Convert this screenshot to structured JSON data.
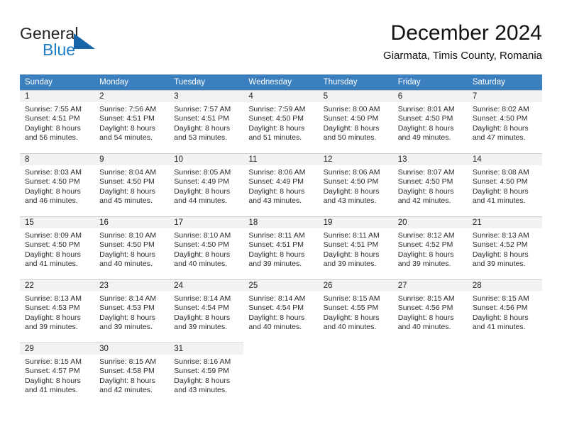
{
  "brand": {
    "name_part1": "General",
    "name_part2": "Blue",
    "logo_icon": "triangle-logo-icon"
  },
  "header": {
    "title": "December 2024",
    "subtitle": "Giarmata, Timis County, Romania"
  },
  "colors": {
    "header_row": "#3b7fbe",
    "brand_blue": "#1b7ec4",
    "logo_dark_blue": "#1565a8",
    "cell_head_bg": "#f2f2f2",
    "grid_line": "#cfcfcf"
  },
  "calendar": {
    "weekday_headers": [
      "Sunday",
      "Monday",
      "Tuesday",
      "Wednesday",
      "Thursday",
      "Friday",
      "Saturday"
    ],
    "weeks": [
      [
        {
          "day": "1",
          "sunrise": "Sunrise: 7:55 AM",
          "sunset": "Sunset: 4:51 PM",
          "daylight_line1": "Daylight: 8 hours",
          "daylight_line2": "and 56 minutes."
        },
        {
          "day": "2",
          "sunrise": "Sunrise: 7:56 AM",
          "sunset": "Sunset: 4:51 PM",
          "daylight_line1": "Daylight: 8 hours",
          "daylight_line2": "and 54 minutes."
        },
        {
          "day": "3",
          "sunrise": "Sunrise: 7:57 AM",
          "sunset": "Sunset: 4:51 PM",
          "daylight_line1": "Daylight: 8 hours",
          "daylight_line2": "and 53 minutes."
        },
        {
          "day": "4",
          "sunrise": "Sunrise: 7:59 AM",
          "sunset": "Sunset: 4:50 PM",
          "daylight_line1": "Daylight: 8 hours",
          "daylight_line2": "and 51 minutes."
        },
        {
          "day": "5",
          "sunrise": "Sunrise: 8:00 AM",
          "sunset": "Sunset: 4:50 PM",
          "daylight_line1": "Daylight: 8 hours",
          "daylight_line2": "and 50 minutes."
        },
        {
          "day": "6",
          "sunrise": "Sunrise: 8:01 AM",
          "sunset": "Sunset: 4:50 PM",
          "daylight_line1": "Daylight: 8 hours",
          "daylight_line2": "and 49 minutes."
        },
        {
          "day": "7",
          "sunrise": "Sunrise: 8:02 AM",
          "sunset": "Sunset: 4:50 PM",
          "daylight_line1": "Daylight: 8 hours",
          "daylight_line2": "and 47 minutes."
        }
      ],
      [
        {
          "day": "8",
          "sunrise": "Sunrise: 8:03 AM",
          "sunset": "Sunset: 4:50 PM",
          "daylight_line1": "Daylight: 8 hours",
          "daylight_line2": "and 46 minutes."
        },
        {
          "day": "9",
          "sunrise": "Sunrise: 8:04 AM",
          "sunset": "Sunset: 4:50 PM",
          "daylight_line1": "Daylight: 8 hours",
          "daylight_line2": "and 45 minutes."
        },
        {
          "day": "10",
          "sunrise": "Sunrise: 8:05 AM",
          "sunset": "Sunset: 4:49 PM",
          "daylight_line1": "Daylight: 8 hours",
          "daylight_line2": "and 44 minutes."
        },
        {
          "day": "11",
          "sunrise": "Sunrise: 8:06 AM",
          "sunset": "Sunset: 4:49 PM",
          "daylight_line1": "Daylight: 8 hours",
          "daylight_line2": "and 43 minutes."
        },
        {
          "day": "12",
          "sunrise": "Sunrise: 8:06 AM",
          "sunset": "Sunset: 4:50 PM",
          "daylight_line1": "Daylight: 8 hours",
          "daylight_line2": "and 43 minutes."
        },
        {
          "day": "13",
          "sunrise": "Sunrise: 8:07 AM",
          "sunset": "Sunset: 4:50 PM",
          "daylight_line1": "Daylight: 8 hours",
          "daylight_line2": "and 42 minutes."
        },
        {
          "day": "14",
          "sunrise": "Sunrise: 8:08 AM",
          "sunset": "Sunset: 4:50 PM",
          "daylight_line1": "Daylight: 8 hours",
          "daylight_line2": "and 41 minutes."
        }
      ],
      [
        {
          "day": "15",
          "sunrise": "Sunrise: 8:09 AM",
          "sunset": "Sunset: 4:50 PM",
          "daylight_line1": "Daylight: 8 hours",
          "daylight_line2": "and 41 minutes."
        },
        {
          "day": "16",
          "sunrise": "Sunrise: 8:10 AM",
          "sunset": "Sunset: 4:50 PM",
          "daylight_line1": "Daylight: 8 hours",
          "daylight_line2": "and 40 minutes."
        },
        {
          "day": "17",
          "sunrise": "Sunrise: 8:10 AM",
          "sunset": "Sunset: 4:50 PM",
          "daylight_line1": "Daylight: 8 hours",
          "daylight_line2": "and 40 minutes."
        },
        {
          "day": "18",
          "sunrise": "Sunrise: 8:11 AM",
          "sunset": "Sunset: 4:51 PM",
          "daylight_line1": "Daylight: 8 hours",
          "daylight_line2": "and 39 minutes."
        },
        {
          "day": "19",
          "sunrise": "Sunrise: 8:11 AM",
          "sunset": "Sunset: 4:51 PM",
          "daylight_line1": "Daylight: 8 hours",
          "daylight_line2": "and 39 minutes."
        },
        {
          "day": "20",
          "sunrise": "Sunrise: 8:12 AM",
          "sunset": "Sunset: 4:52 PM",
          "daylight_line1": "Daylight: 8 hours",
          "daylight_line2": "and 39 minutes."
        },
        {
          "day": "21",
          "sunrise": "Sunrise: 8:13 AM",
          "sunset": "Sunset: 4:52 PM",
          "daylight_line1": "Daylight: 8 hours",
          "daylight_line2": "and 39 minutes."
        }
      ],
      [
        {
          "day": "22",
          "sunrise": "Sunrise: 8:13 AM",
          "sunset": "Sunset: 4:53 PM",
          "daylight_line1": "Daylight: 8 hours",
          "daylight_line2": "and 39 minutes."
        },
        {
          "day": "23",
          "sunrise": "Sunrise: 8:14 AM",
          "sunset": "Sunset: 4:53 PM",
          "daylight_line1": "Daylight: 8 hours",
          "daylight_line2": "and 39 minutes."
        },
        {
          "day": "24",
          "sunrise": "Sunrise: 8:14 AM",
          "sunset": "Sunset: 4:54 PM",
          "daylight_line1": "Daylight: 8 hours",
          "daylight_line2": "and 39 minutes."
        },
        {
          "day": "25",
          "sunrise": "Sunrise: 8:14 AM",
          "sunset": "Sunset: 4:54 PM",
          "daylight_line1": "Daylight: 8 hours",
          "daylight_line2": "and 40 minutes."
        },
        {
          "day": "26",
          "sunrise": "Sunrise: 8:15 AM",
          "sunset": "Sunset: 4:55 PM",
          "daylight_line1": "Daylight: 8 hours",
          "daylight_line2": "and 40 minutes."
        },
        {
          "day": "27",
          "sunrise": "Sunrise: 8:15 AM",
          "sunset": "Sunset: 4:56 PM",
          "daylight_line1": "Daylight: 8 hours",
          "daylight_line2": "and 40 minutes."
        },
        {
          "day": "28",
          "sunrise": "Sunrise: 8:15 AM",
          "sunset": "Sunset: 4:56 PM",
          "daylight_line1": "Daylight: 8 hours",
          "daylight_line2": "and 41 minutes."
        }
      ],
      [
        {
          "day": "29",
          "sunrise": "Sunrise: 8:15 AM",
          "sunset": "Sunset: 4:57 PM",
          "daylight_line1": "Daylight: 8 hours",
          "daylight_line2": "and 41 minutes."
        },
        {
          "day": "30",
          "sunrise": "Sunrise: 8:15 AM",
          "sunset": "Sunset: 4:58 PM",
          "daylight_line1": "Daylight: 8 hours",
          "daylight_line2": "and 42 minutes."
        },
        {
          "day": "31",
          "sunrise": "Sunrise: 8:16 AM",
          "sunset": "Sunset: 4:59 PM",
          "daylight_line1": "Daylight: 8 hours",
          "daylight_line2": "and 43 minutes."
        },
        null,
        null,
        null,
        null
      ]
    ]
  }
}
